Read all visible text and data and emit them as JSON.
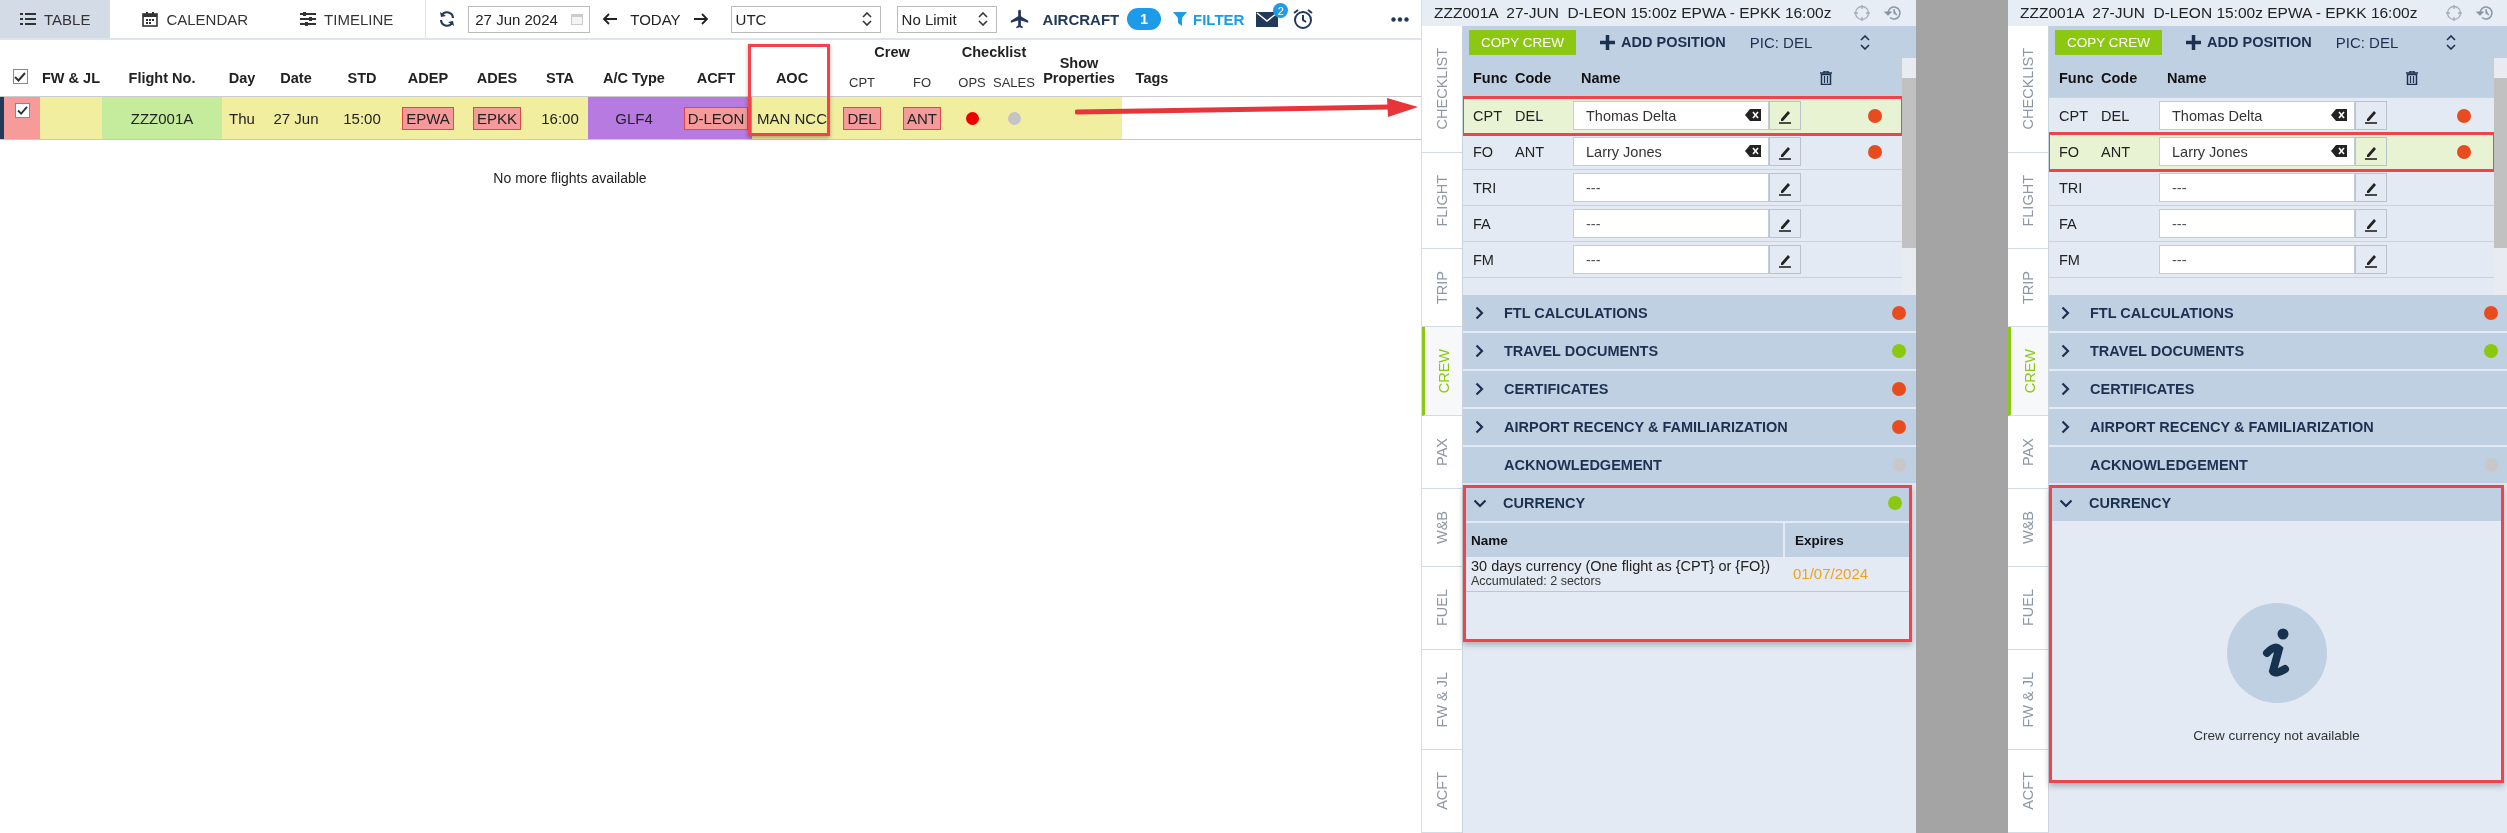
{
  "toolbar": {
    "views": [
      {
        "label": "TABLE",
        "selected": true
      },
      {
        "label": "CALENDAR",
        "selected": false
      },
      {
        "label": "TIMELINE",
        "selected": false
      }
    ],
    "date": "27 Jun 2024",
    "today": "TODAY",
    "timezone": "UTC",
    "limit": "No Limit",
    "aircraft": "AIRCRAFT",
    "aircraft_count": "1",
    "filter": "FILTER",
    "mail_count": "2"
  },
  "table": {
    "columns": [
      {
        "kind": "check",
        "checked": true
      },
      {
        "label": "FW & JL"
      },
      {
        "label": "Flight No."
      },
      {
        "label": "Day"
      },
      {
        "label": "Date"
      },
      {
        "label": "STD"
      },
      {
        "label": "ADEP"
      },
      {
        "label": "ADES"
      },
      {
        "label": "STA"
      },
      {
        "label": "A/C Type"
      },
      {
        "label": "ACFT"
      },
      {
        "label": "AOC",
        "framed": true
      },
      {
        "label": "CPT",
        "group": "Crew"
      },
      {
        "label": "FO",
        "in_group": true
      },
      {
        "label": "OPS",
        "group": "Checklist"
      },
      {
        "label": "SALES",
        "in_group": true
      },
      {
        "label": "Show Properties"
      },
      {
        "label": "Tags"
      }
    ],
    "rows": [
      {
        "cells": [
          {
            "kind": "check",
            "checked": true
          },
          {
            "kind": "blank"
          },
          {
            "kind": "text",
            "text": "ZZZ001A",
            "color": "#c5eb9c"
          },
          {
            "kind": "text",
            "text": "Thu"
          },
          {
            "kind": "text",
            "text": "27 Jun"
          },
          {
            "kind": "text",
            "text": "15:00"
          },
          {
            "kind": "tag",
            "text": "EPWA"
          },
          {
            "kind": "tag",
            "text": "EPKK"
          },
          {
            "kind": "text",
            "text": "16:00"
          },
          {
            "kind": "text",
            "text": "GLF4",
            "color": "#b77ae0"
          },
          {
            "kind": "tag",
            "text": "D-LEON",
            "color": "#b77ae0"
          },
          {
            "kind": "text",
            "text": "MAN NCC"
          },
          {
            "kind": "tag",
            "text": "DEL"
          },
          {
            "kind": "tag",
            "text": "ANT"
          },
          {
            "kind": "dot",
            "color": "#ee0000"
          },
          {
            "kind": "dot",
            "color": "#c4c4c4"
          },
          {
            "kind": "blank"
          }
        ]
      }
    ],
    "note": "No more flights available"
  },
  "panels": [
    {
      "title": "ZZZ001A  27-JUN  D-LEON 15:00z EPWA - EPKK 16:00z",
      "tabs": [
        {
          "label": "CHECKLIST",
          "selected": false
        },
        {
          "label": "FLIGHT",
          "selected": false
        },
        {
          "label": "TRIP",
          "selected": false
        },
        {
          "label": "CREW",
          "selected": true
        },
        {
          "label": "PAX",
          "selected": false
        },
        {
          "label": "W&B",
          "selected": false
        },
        {
          "label": "FUEL",
          "selected": false
        },
        {
          "label": "FW & JL",
          "selected": false
        },
        {
          "label": "ACFT",
          "selected": false
        }
      ],
      "copy_crew": "COPY CREW",
      "add_position": "ADD POSITION",
      "pic": "PIC: DEL",
      "crew_columns": [
        "Func",
        "Code",
        "Name"
      ],
      "crew": [
        {
          "func": "CPT",
          "code": "DEL",
          "name": "Thomas Delta",
          "selected": true,
          "framed": true,
          "color": "#e84c1e"
        },
        {
          "func": "FO",
          "code": "ANT",
          "name": "Larry Jones",
          "selected": false,
          "framed": false,
          "color": "#e84c1e"
        },
        {
          "func": "TRI",
          "placeholder": "---",
          "selected": false,
          "framed": false
        },
        {
          "func": "FA",
          "placeholder": "---",
          "selected": false,
          "framed": false
        },
        {
          "func": "FM",
          "placeholder": "---",
          "selected": false,
          "framed": false
        }
      ],
      "sections": [
        {
          "kind": "toggle",
          "title": "FTL CALCULATIONS",
          "expanded": false,
          "color": "#e84c1e"
        },
        {
          "kind": "toggle",
          "title": "TRAVEL DOCUMENTS",
          "expanded": false,
          "color": "#8cc812"
        },
        {
          "kind": "toggle",
          "title": "CERTIFICATES",
          "expanded": false,
          "color": "#e84c1e"
        },
        {
          "kind": "toggle",
          "title": "AIRPORT RECENCY & FAMILIARIZATION",
          "expanded": false,
          "color": "#e84c1e"
        },
        {
          "kind": "plain",
          "title": "ACKNOWLEDGEMENT",
          "expanded": false,
          "color": "#c8c8c8"
        },
        {
          "kind": "toggle",
          "title": "CURRENCY",
          "expanded": true,
          "framed": true,
          "color": "#8cc812"
        }
      ],
      "currency": {
        "kind": "table",
        "columns": [
          "Name",
          "Expires"
        ],
        "rows": [
          {
            "name": "30 days currency (One flight as {CPT} or {FO})",
            "detail": "Accumulated: 2 sectors",
            "expires": "01/07/2024"
          }
        ]
      }
    },
    {
      "title": "ZZZ001A  27-JUN  D-LEON 15:00z EPWA - EPKK 16:00z",
      "tabs": [
        {
          "label": "CHECKLIST",
          "selected": false
        },
        {
          "label": "FLIGHT",
          "selected": false
        },
        {
          "label": "TRIP",
          "selected": false
        },
        {
          "label": "CREW",
          "selected": true
        },
        {
          "label": "PAX",
          "selected": false
        },
        {
          "label": "W&B",
          "selected": false
        },
        {
          "label": "FUEL",
          "selected": false
        },
        {
          "label": "FW & JL",
          "selected": false
        },
        {
          "label": "ACFT",
          "selected": false
        }
      ],
      "copy_crew": "COPY CREW",
      "add_position": "ADD POSITION",
      "pic": "PIC: DEL",
      "crew_columns": [
        "Func",
        "Code",
        "Name"
      ],
      "crew": [
        {
          "func": "CPT",
          "code": "DEL",
          "name": "Thomas Delta",
          "selected": false,
          "framed": false,
          "color": "#e84c1e"
        },
        {
          "func": "FO",
          "code": "ANT",
          "name": "Larry Jones",
          "selected": true,
          "framed": true,
          "color": "#e84c1e"
        },
        {
          "func": "TRI",
          "placeholder": "---",
          "selected": false,
          "framed": false
        },
        {
          "func": "FA",
          "placeholder": "---",
          "selected": false,
          "framed": false
        },
        {
          "func": "FM",
          "placeholder": "---",
          "selected": false,
          "framed": false
        }
      ],
      "sections": [
        {
          "kind": "toggle",
          "title": "FTL CALCULATIONS",
          "expanded": false,
          "color": "#e84c1e"
        },
        {
          "kind": "toggle",
          "title": "TRAVEL DOCUMENTS",
          "expanded": false,
          "color": "#8cc812"
        },
        {
          "kind": "toggle",
          "title": "CERTIFICATES",
          "expanded": false
        },
        {
          "kind": "toggle",
          "title": "AIRPORT RECENCY & FAMILIARIZATION",
          "expanded": false
        },
        {
          "kind": "plain",
          "title": "ACKNOWLEDGEMENT",
          "expanded": false,
          "color": "#c8c8c8"
        },
        {
          "kind": "toggle",
          "title": "CURRENCY",
          "expanded": true,
          "framed": true
        }
      ],
      "currency": {
        "kind": "empty",
        "message": "Crew currency not available"
      }
    }
  ]
}
